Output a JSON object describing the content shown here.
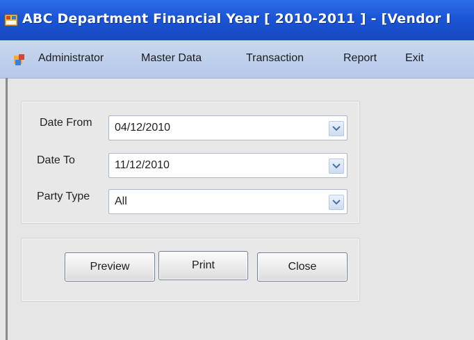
{
  "window": {
    "title": "ABC Department Financial Year [ 2010-2011 ] - [Vendor I"
  },
  "menu": {
    "items": [
      "Administrator",
      "Master Data",
      "Transaction",
      "Report",
      "Exit"
    ]
  },
  "form": {
    "date_from": {
      "label": "Date From",
      "value": "04/12/2010"
    },
    "date_to": {
      "label": "Date To",
      "value": "11/12/2010"
    },
    "party_type": {
      "label": "Party Type",
      "value": "All"
    }
  },
  "buttons": {
    "preview": "Preview",
    "print": "Print",
    "close": "Close"
  }
}
